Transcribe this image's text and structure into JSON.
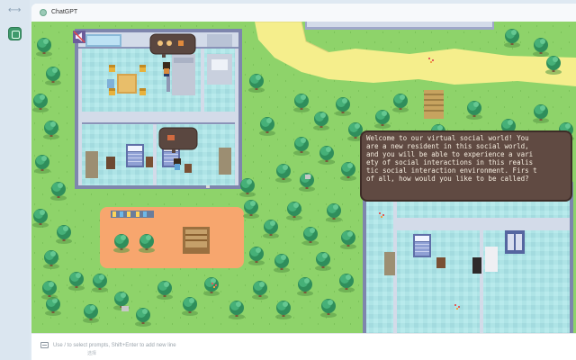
{
  "sidebar": {
    "toggle_glyph": "⟷",
    "app_icon": "chatgpt-app-icon"
  },
  "window": {
    "title": "ChatGPT",
    "title_icon": "chatgpt-logo-icon"
  },
  "game": {
    "dialog_text": "Welcome to our virtual social world! You\nare a new resident in this social world,\nand you will be able to experience a vari\nety of social interactions in this realis\ntic social interaction environment. Firs t\nof all, how would you like to be called?",
    "npc_bubble_icon": "speech-bubble-icon",
    "sound_icon": "muted-speaker-icon",
    "colors": {
      "grass": "#8ed36a",
      "path": "#f7f08f",
      "plaza": "#f7a66e",
      "floor": "#aee4e6",
      "wall": "#9fa7c9",
      "tree": "#3fa86b",
      "dialog_bg": "#604a42"
    }
  },
  "composer": {
    "placeholder": "Use / to select prompts, Shift+Enter to add new line",
    "extra": "选择",
    "icon": "prompt-icon"
  }
}
